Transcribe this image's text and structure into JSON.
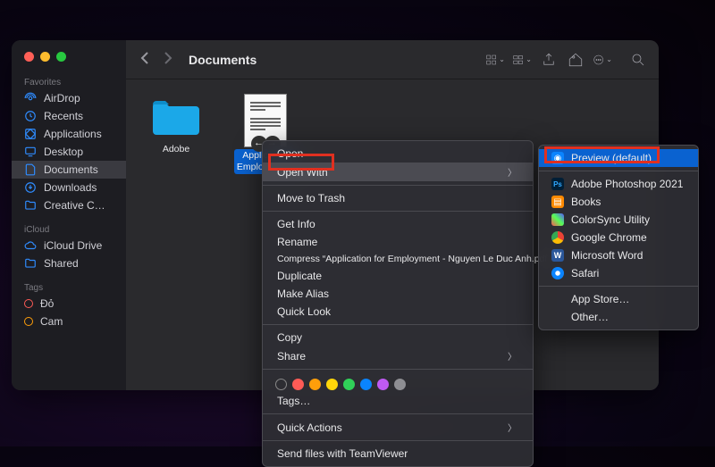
{
  "window": {
    "title": "Documents"
  },
  "sidebar": {
    "sections": {
      "favorites": {
        "label": "Favorites",
        "items": [
          {
            "label": "AirDrop",
            "icon": "airdrop"
          },
          {
            "label": "Recents",
            "icon": "clock"
          },
          {
            "label": "Applications",
            "icon": "apps"
          },
          {
            "label": "Desktop",
            "icon": "desktop"
          },
          {
            "label": "Documents",
            "icon": "document",
            "active": true
          },
          {
            "label": "Downloads",
            "icon": "download"
          },
          {
            "label": "Creative C…",
            "icon": "folder"
          }
        ]
      },
      "icloud": {
        "label": "iCloud",
        "items": [
          {
            "label": "iCloud Drive",
            "icon": "cloud"
          },
          {
            "label": "Shared",
            "icon": "shared"
          }
        ]
      },
      "tags": {
        "label": "Tags",
        "items": [
          {
            "label": "Đỏ",
            "color": "#ff5b56"
          },
          {
            "label": "Cam",
            "color": "#ff9e0a"
          }
        ]
      }
    }
  },
  "files": [
    {
      "name": "Adobe",
      "type": "folder"
    },
    {
      "name": "Application\nEmploy…Anh",
      "type": "pdf",
      "selected": true
    }
  ],
  "context_menu": {
    "items": [
      {
        "label": "Open"
      },
      {
        "label": "Open With",
        "submenu": true,
        "highlighted": true
      },
      {
        "sep": true
      },
      {
        "label": "Move to Trash"
      },
      {
        "sep": true
      },
      {
        "label": "Get Info"
      },
      {
        "label": "Rename"
      },
      {
        "label": "Compress “Application for Employment - Nguyen Le Duc Anh.pdf”"
      },
      {
        "label": "Duplicate"
      },
      {
        "label": "Make Alias"
      },
      {
        "label": "Quick Look"
      },
      {
        "sep": true
      },
      {
        "label": "Copy"
      },
      {
        "label": "Share",
        "submenu": true
      },
      {
        "sep": true
      },
      {
        "tags": true
      },
      {
        "label": "Tags…"
      },
      {
        "sep": true
      },
      {
        "label": "Quick Actions",
        "submenu": true
      },
      {
        "sep": true
      },
      {
        "label": "Send files with TeamViewer"
      }
    ],
    "tag_colors": [
      "#ff5b56",
      "#ff9e0a",
      "#ffd60a",
      "#30d158",
      "#0a84ff",
      "#bf5af2",
      "#8e8e93"
    ]
  },
  "submenu": {
    "items": [
      {
        "label": "Preview (default)",
        "icon_bg": "#0a84ff",
        "selected": true
      },
      {
        "sep": true
      },
      {
        "label": "Adobe Photoshop 2021",
        "icon_bg": "#001e36"
      },
      {
        "label": "Books",
        "icon_bg": "#ff8a00"
      },
      {
        "label": "ColorSync Utility",
        "icon_bg": "#5a5a60"
      },
      {
        "label": "Google Chrome",
        "icon_bg": "#ea4335"
      },
      {
        "label": "Microsoft Word",
        "icon_bg": "#2b579a"
      },
      {
        "label": "Safari",
        "icon_bg": "#0a84ff"
      },
      {
        "sep": true
      },
      {
        "label": "App Store…"
      },
      {
        "label": "Other…"
      }
    ]
  }
}
